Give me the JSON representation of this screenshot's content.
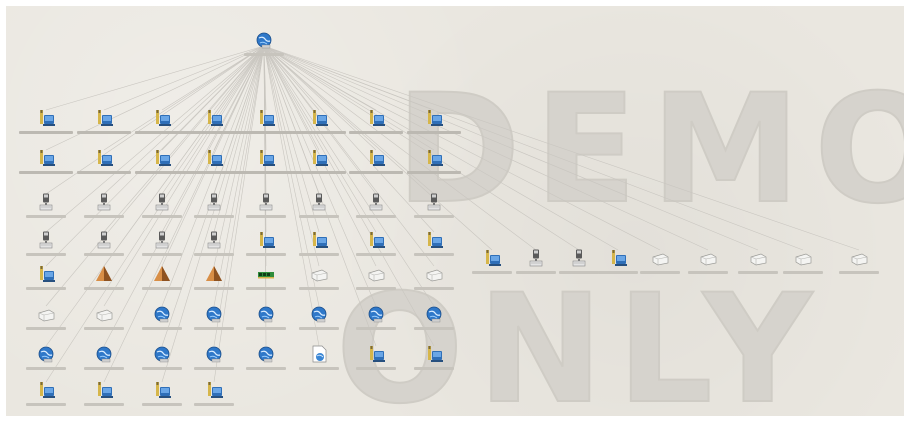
{
  "watermark": {
    "line1": "DEMO",
    "line2": "ONLY",
    "color": "#d6d3cd"
  },
  "background_color": "#eae7e0",
  "edge_color": "#c9c6c0",
  "graph": {
    "root": {
      "icon": "network-globe-icon"
    },
    "grid_rows": [
      [
        "server-pc-icon",
        "server-pc-icon",
        "server-pc-icon",
        "server-pc-icon",
        "server-pc-icon",
        "server-pc-icon",
        "server-pc-icon",
        "server-pc-icon"
      ],
      [
        "server-pc-icon",
        "server-pc-icon",
        "server-pc-icon",
        "server-pc-icon",
        "server-pc-icon",
        "server-pc-icon",
        "server-pc-icon",
        "server-pc-icon"
      ],
      [
        "desktop-tower-icon",
        "desktop-tower-icon",
        "desktop-tower-icon",
        "desktop-tower-icon",
        "desktop-tower-icon",
        "desktop-tower-icon",
        "desktop-tower-icon",
        "desktop-tower-icon"
      ],
      [
        "desktop-tower-icon",
        "desktop-tower-icon",
        "desktop-tower-icon",
        "desktop-tower-icon",
        "server-pc-icon",
        "server-pc-icon",
        "server-pc-icon",
        "server-pc-icon"
      ],
      [
        "server-pc-icon",
        "pyramid-icon",
        "pyramid-icon",
        "pyramid-icon",
        "memory-module-icon",
        "cloud-device-icon",
        "cloud-device-icon",
        "cloud-device-icon"
      ],
      [
        "cloud-device-icon",
        "cloud-device-icon",
        "network-globe-icon",
        "network-globe-icon",
        "network-globe-icon",
        "network-globe-icon",
        "network-globe-icon",
        "network-globe-icon"
      ],
      [
        "network-globe-icon",
        "network-globe-icon",
        "network-globe-icon",
        "network-globe-icon",
        "network-globe-icon",
        "document-globe-icon",
        "server-pc-icon",
        "server-pc-icon"
      ],
      [
        "server-pc-icon",
        "server-pc-icon",
        "server-pc-icon",
        "server-pc-icon"
      ]
    ],
    "side_nodes": [
      "server-pc-icon",
      "desktop-tower-icon",
      "desktop-tower-icon",
      "server-pc-icon",
      "cloud-device-icon",
      "cloud-device-icon",
      "cloud-device-icon",
      "cloud-device-icon",
      "cloud-device-icon"
    ]
  }
}
